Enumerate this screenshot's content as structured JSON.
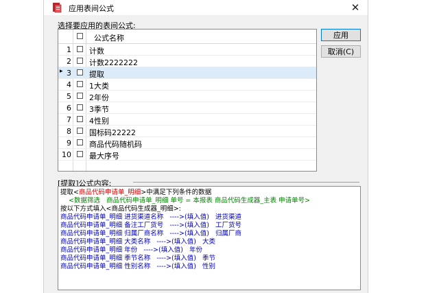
{
  "window": {
    "title": "应用表间公式",
    "close_glyph": "✕"
  },
  "formula_list": {
    "label": "选择要应用的表间公式:",
    "column_name": "公式名称",
    "selected_marker": "▸",
    "rows": [
      {
        "num": "1",
        "name": "计数",
        "selected": false
      },
      {
        "num": "2",
        "name": "计数2222222",
        "selected": false
      },
      {
        "num": "3",
        "name": "提取",
        "selected": true
      },
      {
        "num": "4",
        "name": "1大类",
        "selected": false
      },
      {
        "num": "5",
        "name": "2年份",
        "selected": false
      },
      {
        "num": "6",
        "name": "3季节",
        "selected": false
      },
      {
        "num": "7",
        "name": "4性别",
        "selected": false
      },
      {
        "num": "8",
        "name": "国标码22222",
        "selected": false
      },
      {
        "num": "9",
        "name": "商品代码随机码",
        "selected": false
      },
      {
        "num": "10",
        "name": "最大序号",
        "selected": false
      }
    ]
  },
  "buttons": {
    "apply": "应用",
    "cancel": "取消(C)"
  },
  "formula_content": {
    "label": "[提取]公式内容:",
    "lines": [
      {
        "c1": "提取<",
        "c2": "商品代码申请单_明细",
        "c3": ">中满足下列条件的数据"
      },
      {
        "text": "    <数据筛选   商品代码申请单_明细 单号 = 本报表 商品代码生成器_主表 申请单号>"
      },
      {
        "text": "按以下方式填入<商品代码生成器_明细>:"
      },
      {
        "text": "商品代码申请单_明细 进货渠道名称   ---->(填入值)   进货渠道"
      },
      {
        "text": "商品代码申请单_明细 备注工厂货号   ---->(填入值)   工厂货号"
      },
      {
        "text": "商品代码申请单_明细 归属厂商名称   ---->(填入值)   归属厂商"
      },
      {
        "text": "商品代码申请单_明细 大类名称   ---->(填入值)   大类"
      },
      {
        "text": "商品代码申请单_明细 年份   ---->(填入值)   年份"
      },
      {
        "text": "商品代码申请单_明细 季节名称   ---->(填入值)   季节"
      },
      {
        "text": "商品代码申请单_明细 性别名称   ---->(填入值)   性别"
      }
    ]
  },
  "colors": {
    "selection": "#dcebf8",
    "red_text": "#d00000",
    "green_text": "#008000",
    "blue_text": "#0000c8",
    "accent": "#0078d7"
  }
}
